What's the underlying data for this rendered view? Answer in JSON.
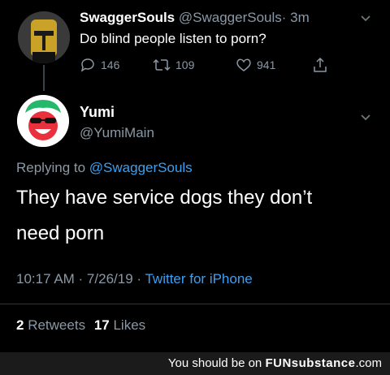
{
  "original_tweet": {
    "display_name": "SwaggerSouls",
    "handle": "@SwaggerSouls",
    "age": "· 3m",
    "text": "Do blind people listen to porn?",
    "replies": "146",
    "retweets": "109",
    "likes": "941"
  },
  "reply": {
    "display_name": "Yumi",
    "handle": "@YumiMain",
    "replying_prefix": "Replying to",
    "replying_handle": "@SwaggerSouls",
    "text_line1": "They have service dogs they don’t",
    "text_line2": "need porn",
    "time_date": "10:17 AM · 7/26/19 ·",
    "source": "Twitter for iPhone",
    "retweet_count": "2",
    "retweet_label": "Retweets",
    "like_count": "17",
    "like_label": "Likes"
  },
  "footer": {
    "prefix": "You should be on",
    "brand": "FUNsubstance",
    "suffix": ".com"
  },
  "colors": {
    "link": "#3ba0f2",
    "muted": "#8b98a5",
    "background": "#000000"
  }
}
